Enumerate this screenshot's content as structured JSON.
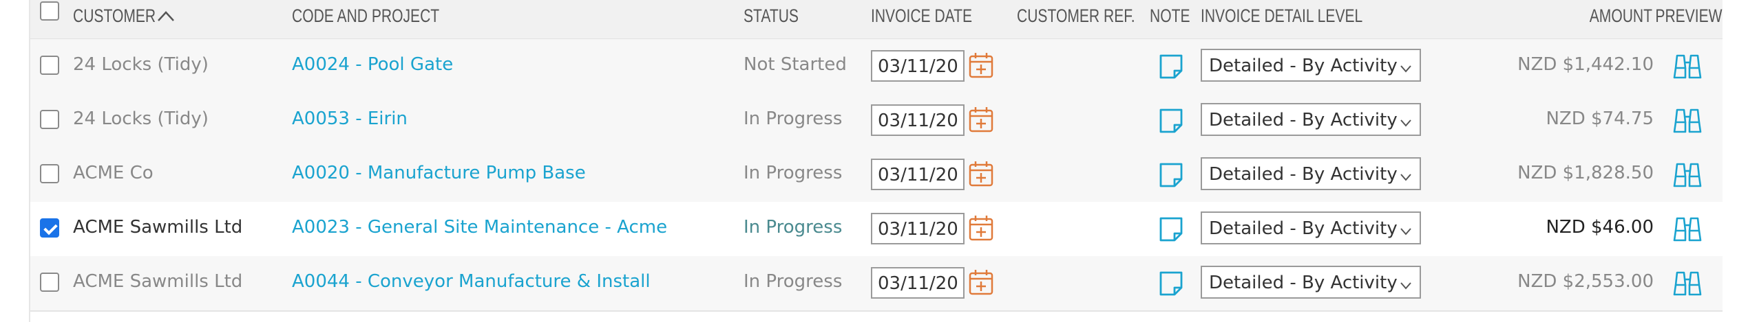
{
  "colors": {
    "link": "#1aa3cf",
    "accent_orange": "#e07a3a",
    "icon_blue": "#1aa3cf",
    "checkbox_checked": "#1a73e8"
  },
  "header": {
    "customer": "CUSTOMER",
    "sort_icon": "chevron-up-icon",
    "code_project": "CODE AND PROJECT",
    "status": "STATUS",
    "invoice_date": "INVOICE DATE",
    "customer_ref": "CUSTOMER REF.",
    "note": "NOTE",
    "detail_level": "INVOICE DETAIL LEVEL",
    "amount": "AMOUNT",
    "preview": "PREVIEW"
  },
  "rows": [
    {
      "checked": false,
      "customer": "24 Locks (Tidy)",
      "project": "A0024 - Pool Gate",
      "status": "Not Started",
      "invoice_date": "03/11/20",
      "customer_ref": "",
      "detail_level": "Detailed - By Activity",
      "amount": "NZD $1,442.10"
    },
    {
      "checked": false,
      "customer": "24 Locks (Tidy)",
      "project": "A0053 - Eirin",
      "status": "In Progress",
      "invoice_date": "03/11/20",
      "customer_ref": "",
      "detail_level": "Detailed - By Activity",
      "amount": "NZD $74.75"
    },
    {
      "checked": false,
      "customer": "ACME Co",
      "project": "A0020 - Manufacture Pump Base",
      "status": "In Progress",
      "invoice_date": "03/11/20",
      "customer_ref": "",
      "detail_level": "Detailed - By Activity",
      "amount": "NZD $1,828.50"
    },
    {
      "checked": true,
      "customer": "ACME Sawmills Ltd",
      "project": "A0023 - General Site Maintenance - Acme",
      "status": "In Progress",
      "invoice_date": "03/11/20",
      "customer_ref": "",
      "detail_level": "Detailed - By Activity",
      "amount": "NZD $46.00"
    },
    {
      "checked": false,
      "customer": "ACME Sawmills Ltd",
      "project": "A0044 - Conveyor Manufacture & Install",
      "status": "In Progress",
      "invoice_date": "03/11/20",
      "customer_ref": "",
      "detail_level": "Detailed - By Activity",
      "amount": "NZD $2,553.00"
    }
  ]
}
